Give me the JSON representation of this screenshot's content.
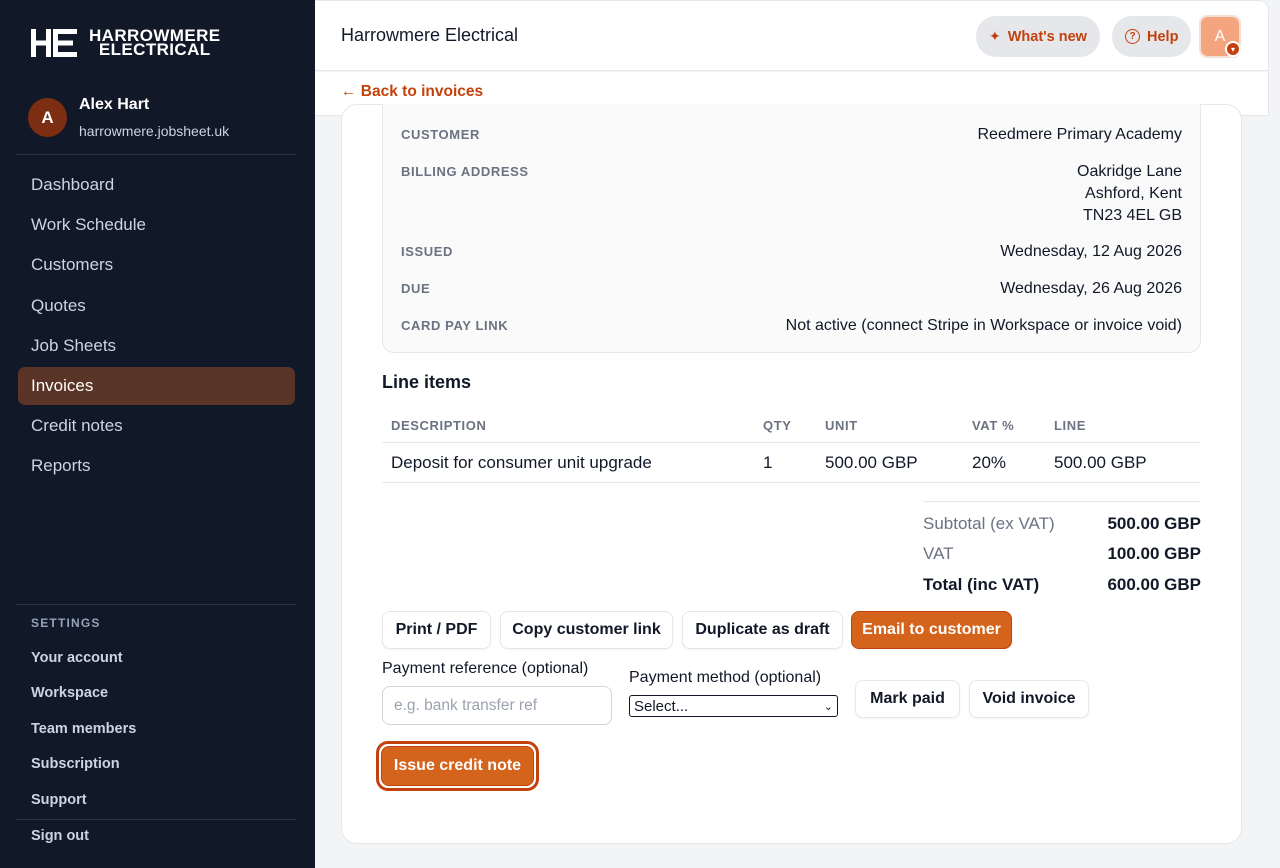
{
  "sidebar": {
    "logo_mark": "HE",
    "logo_line1": "HARROWMERE",
    "logo_line2": "ELECTRICAL",
    "user": {
      "initial": "A",
      "name": "Alex Hart",
      "domain": "harrowmere.jobsheet.uk"
    },
    "nav": [
      {
        "label": "Dashboard",
        "active": false
      },
      {
        "label": "Work Schedule",
        "active": false
      },
      {
        "label": "Customers",
        "active": false
      },
      {
        "label": "Quotes",
        "active": false
      },
      {
        "label": "Job Sheets",
        "active": false
      },
      {
        "label": "Invoices",
        "active": true
      },
      {
        "label": "Credit notes",
        "active": false
      },
      {
        "label": "Reports",
        "active": false
      }
    ],
    "settings_heading": "SETTINGS",
    "settings": [
      "Your account",
      "Workspace",
      "Team members",
      "Subscription",
      "Support"
    ],
    "sign_out": "Sign out"
  },
  "header": {
    "title": "Harrowmere Electrical",
    "whats_new": "What's new",
    "help": "Help",
    "avatar_initial": "A"
  },
  "back_link": "← Back to invoices",
  "details": {
    "customer_label": "CUSTOMER",
    "customer": "Reedmere Primary Academy",
    "billing_label": "BILLING ADDRESS",
    "billing_lines": [
      "Oakridge Lane",
      "Ashford, Kent",
      "TN23 4EL GB"
    ],
    "issued_label": "ISSUED",
    "issued": "Wednesday, 12 Aug 2026",
    "due_label": "DUE",
    "due": "Wednesday, 26 Aug 2026",
    "card_pay_label": "CARD PAY LINK",
    "card_pay": "Not active (connect Stripe in Workspace or invoice void)"
  },
  "line_items": {
    "heading": "Line items",
    "columns": [
      "DESCRIPTION",
      "QTY",
      "UNIT",
      "VAT %",
      "LINE"
    ],
    "rows": [
      [
        "Deposit for consumer unit upgrade",
        "1",
        "500.00 GBP",
        "20%",
        "500.00 GBP"
      ]
    ]
  },
  "totals": {
    "subtotal_label": "Subtotal (ex VAT)",
    "subtotal": "500.00 GBP",
    "vat_label": "VAT",
    "vat": "100.00 GBP",
    "total_label": "Total (inc VAT)",
    "total": "600.00 GBP"
  },
  "actions": {
    "print": "Print / PDF",
    "copy_link": "Copy customer link",
    "duplicate": "Duplicate as draft",
    "email": "Email to customer",
    "payment_ref_label": "Payment reference (optional)",
    "payment_ref_placeholder": "e.g. bank transfer ref",
    "payment_method_label": "Payment method (optional)",
    "payment_method_value": "Select...",
    "mark_paid": "Mark paid",
    "void": "Void invoice",
    "credit_note": "Issue credit note"
  },
  "colors": {
    "accent": "#c2410c",
    "sidebar_bg": "#111827",
    "active_nav": "#5a3426"
  }
}
